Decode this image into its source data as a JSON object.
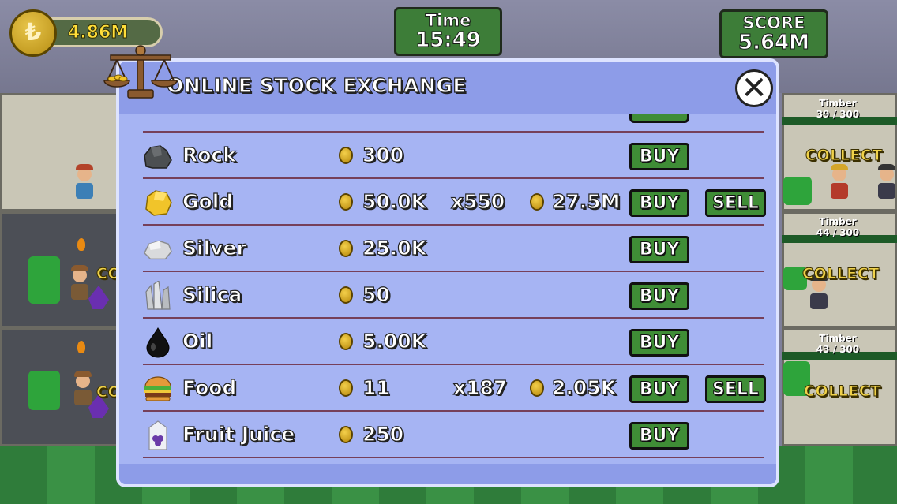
{
  "hud": {
    "currency_symbol": "₺",
    "money": "4.86M",
    "time_label": "Time",
    "time_value": "15:49",
    "score_label": "SCORE",
    "score_value": "5.64M"
  },
  "background": {
    "rooms": [
      {
        "label_name": "Timber",
        "label_count": "39 / 300",
        "action": "COLLECT"
      },
      {
        "label_name": "Timber",
        "label_count": "44 / 300",
        "action": "COLLECT"
      },
      {
        "label_name": "Timber",
        "label_count": "43 / 300",
        "action": "COLLECT"
      }
    ],
    "left_partial_labels": [
      "CO",
      "CO"
    ]
  },
  "modal": {
    "title": "ONLINE STOCK EXCHANGE",
    "close_icon": "close-x-icon",
    "rows": [
      {
        "name": "Rock",
        "icon": "rock-icon",
        "price": "300",
        "qty": "",
        "value": "",
        "buy": "BUY",
        "sell": ""
      },
      {
        "name": "Gold",
        "icon": "gold-nugget-icon",
        "price": "50.0K",
        "qty": "x550",
        "value": "27.5M",
        "buy": "BUY",
        "sell": "SELL"
      },
      {
        "name": "Silver",
        "icon": "silver-ore-icon",
        "price": "25.0K",
        "qty": "",
        "value": "",
        "buy": "BUY",
        "sell": ""
      },
      {
        "name": "Silica",
        "icon": "silica-crystal-icon",
        "price": "50",
        "qty": "",
        "value": "",
        "buy": "BUY",
        "sell": ""
      },
      {
        "name": "Oil",
        "icon": "oil-drop-icon",
        "price": "5.00K",
        "qty": "",
        "value": "",
        "buy": "BUY",
        "sell": ""
      },
      {
        "name": "Food",
        "icon": "burger-icon",
        "price": "11",
        "qty": "x187",
        "value": "2.05K",
        "buy": "BUY",
        "sell": "SELL"
      },
      {
        "name": "Fruit Juice",
        "icon": "juice-carton-icon",
        "price": "250",
        "qty": "",
        "value": "",
        "buy": "BUY",
        "sell": ""
      }
    ]
  },
  "colors": {
    "modal_bg": "#a6b4f3",
    "modal_header": "#8d9ce8",
    "button_green": "#3f8d36",
    "row_divider": "#76405a",
    "coin_gold": "#e0b52c"
  }
}
